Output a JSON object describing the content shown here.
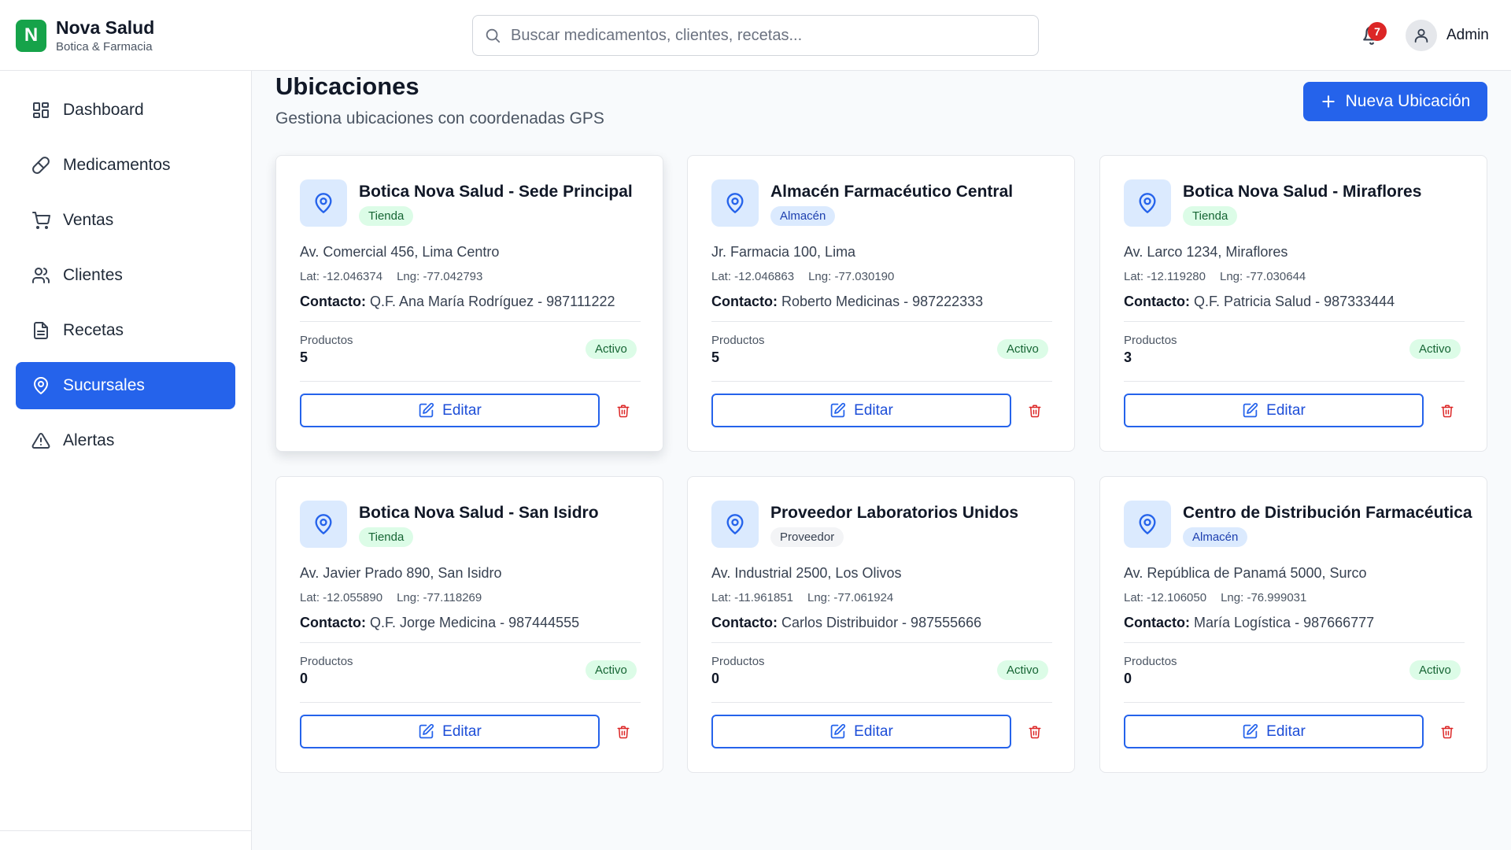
{
  "brand": {
    "logo_letter": "N",
    "name": "Nova Salud",
    "subtitle": "Botica & Farmacia",
    "color": "#16a34a"
  },
  "search": {
    "placeholder": "Buscar medicamentos, clientes, recetas..."
  },
  "notifications": {
    "count": "7"
  },
  "user": {
    "name": "Admin"
  },
  "sidebar": {
    "items": [
      {
        "label": "Dashboard",
        "icon": "dashboard-icon"
      },
      {
        "label": "Medicamentos",
        "icon": "pill-icon"
      },
      {
        "label": "Ventas",
        "icon": "cart-icon"
      },
      {
        "label": "Clientes",
        "icon": "users-icon"
      },
      {
        "label": "Recetas",
        "icon": "file-text-icon"
      },
      {
        "label": "Sucursales",
        "icon": "map-pin-icon",
        "active": true
      },
      {
        "label": "Alertas",
        "icon": "alert-triangle-icon"
      }
    ]
  },
  "page": {
    "title": "Ubicaciones",
    "subtitle": "Gestiona ubicaciones con coordenadas GPS",
    "new_button": "Nueva Ubicación"
  },
  "labels": {
    "contact": "Contacto:",
    "products": "Productos",
    "edit": "Editar"
  },
  "locations": [
    {
      "name": "Botica Nova Salud - Sede Principal",
      "type": "Tienda",
      "address": "Av. Comercial 456, Lima Centro",
      "lat": "Lat: -12.046374",
      "lng": "Lng: -77.042793",
      "contact": "Q.F. Ana María Rodríguez - 987111222",
      "products": "5",
      "status": "Activo"
    },
    {
      "name": "Almacén Farmacéutico Central",
      "type": "Almacén",
      "address": "Jr. Farmacia 100, Lima",
      "lat": "Lat: -12.046863",
      "lng": "Lng: -77.030190",
      "contact": "Roberto Medicinas - 987222333",
      "products": "5",
      "status": "Activo"
    },
    {
      "name": "Botica Nova Salud - Miraflores",
      "type": "Tienda",
      "address": "Av. Larco 1234, Miraflores",
      "lat": "Lat: -12.119280",
      "lng": "Lng: -77.030644",
      "contact": "Q.F. Patricia Salud - 987333444",
      "products": "3",
      "status": "Activo"
    },
    {
      "name": "Botica Nova Salud - San Isidro",
      "type": "Tienda",
      "address": "Av. Javier Prado 890, San Isidro",
      "lat": "Lat: -12.055890",
      "lng": "Lng: -77.118269",
      "contact": "Q.F. Jorge Medicina - 987444555",
      "products": "0",
      "status": "Activo"
    },
    {
      "name": "Proveedor Laboratorios Unidos",
      "type": "Proveedor",
      "address": "Av. Industrial 2500, Los Olivos",
      "lat": "Lat: -11.961851",
      "lng": "Lng: -77.061924",
      "contact": "Carlos Distribuidor - 987555666",
      "products": "0",
      "status": "Activo"
    },
    {
      "name": "Centro de Distribución Farmacéutica",
      "type": "Almacén",
      "address": "Av. República de Panamá 5000, Surco",
      "lat": "Lat: -12.106050",
      "lng": "Lng: -76.999031",
      "contact": "María Logística - 987666777",
      "products": "0",
      "status": "Activo"
    }
  ],
  "colors": {
    "primary": "#2563eb",
    "danger": "#dc2626",
    "success_bg": "#dcfce7",
    "success_text": "#166534"
  }
}
